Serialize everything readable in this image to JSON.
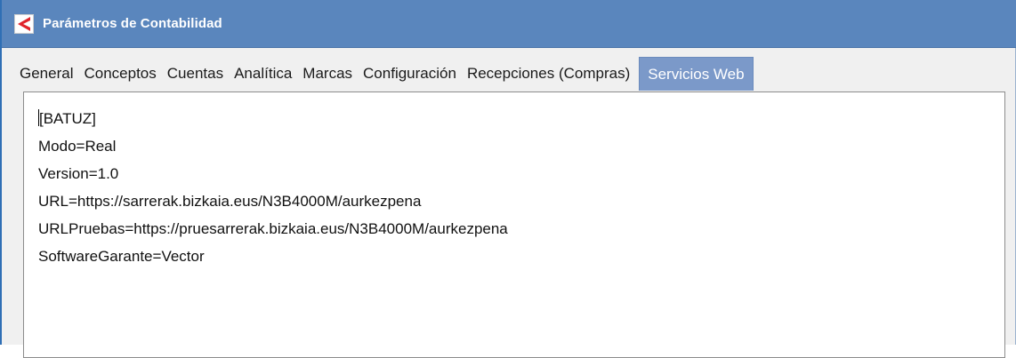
{
  "window": {
    "title": "Parámetros de Contabilidad",
    "accent_color": "#5a86bd",
    "app_icon": "chevron-left-logo-icon",
    "app_icon_color": "#e0232b"
  },
  "tabs": [
    {
      "label": "General",
      "active": false
    },
    {
      "label": "Conceptos",
      "active": false
    },
    {
      "label": "Cuentas",
      "active": false
    },
    {
      "label": "Analítica",
      "active": false
    },
    {
      "label": "Marcas",
      "active": false
    },
    {
      "label": "Configuración",
      "active": false
    },
    {
      "label": "Recepciones (Compras)",
      "active": false
    },
    {
      "label": "Servicios Web",
      "active": true
    }
  ],
  "editor": {
    "lines": [
      "[BATUZ]",
      "Modo=Real",
      "Version=1.0",
      "URL=https://sarrerak.bizkaia.eus/N3B4000M/aurkezpena",
      "URLPruebas=https://pruesarrerak.bizkaia.eus/N3B4000M/aurkezpena",
      "SoftwareGarante=Vector"
    ]
  }
}
